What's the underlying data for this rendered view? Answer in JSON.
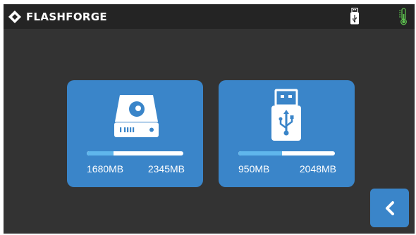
{
  "header": {
    "brand": "FLASHFORGE",
    "icons": [
      "flashforge-logo-icon",
      "usb-drive-status-icon",
      "thermometer-icon"
    ]
  },
  "storage": [
    {
      "name": "internal-storage",
      "icon": "hard-drive-icon",
      "used": "1680MB",
      "total": "2345MB",
      "used_fraction": 0.28
    },
    {
      "name": "usb-storage",
      "icon": "usb-drive-icon",
      "used": "950MB",
      "total": "2048MB",
      "used_fraction": 0.45
    }
  ],
  "footer": {
    "back_icon": "chevron-left-icon"
  },
  "colors": {
    "topbar": "#242424",
    "background": "#333333",
    "card": "#3a85c9",
    "progress_fill": "#5fb6ec",
    "progress_track": "#ffffff",
    "thermometer": "#5cbf4e"
  }
}
